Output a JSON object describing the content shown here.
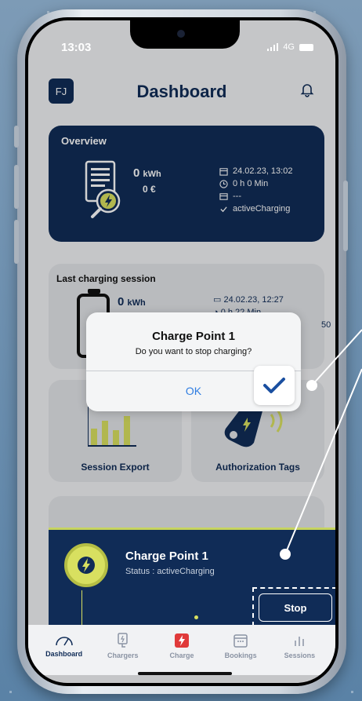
{
  "status_bar": {
    "time": "13:03",
    "network": "4G"
  },
  "header": {
    "avatar_initials": "FJ",
    "title": "Dashboard"
  },
  "overview": {
    "title": "Overview",
    "energy_value": "0",
    "energy_unit": "kWh",
    "cost": "0 €",
    "date": "24.02.23, 13:02",
    "duration": "0 h 0 Min",
    "id": "---",
    "status": "activeCharging"
  },
  "last_session": {
    "title": "Last charging session",
    "energy_value": "0",
    "energy_unit": "kWh",
    "date": "24.02.23, 12:27",
    "duration": "0 h 22 Min",
    "extra": "50"
  },
  "tiles": {
    "session_export": "Session Export",
    "authorization_tags": "Authorization Tags"
  },
  "dialog": {
    "title": "Charge Point 1",
    "message": "Do you want to stop charging?",
    "ok_label": "OK"
  },
  "charging_panel": {
    "name": "Charge Point 1",
    "status": "Status : activeCharging",
    "stop_label": "Stop"
  },
  "tabs": [
    {
      "label": "Dashboard",
      "icon": "gauge-icon",
      "active": true
    },
    {
      "label": "Chargers",
      "icon": "charger-icon",
      "active": false
    },
    {
      "label": "Charge",
      "icon": "bolt-icon",
      "active": false
    },
    {
      "label": "Bookings",
      "icon": "calendar-icon",
      "active": false
    },
    {
      "label": "Sessions",
      "icon": "bar-chart-icon",
      "active": false
    }
  ],
  "colors": {
    "navy": "#102c57",
    "accent_yellow": "#d8e060",
    "link_blue": "#2f7de1",
    "charge_red": "#e03a3a"
  }
}
